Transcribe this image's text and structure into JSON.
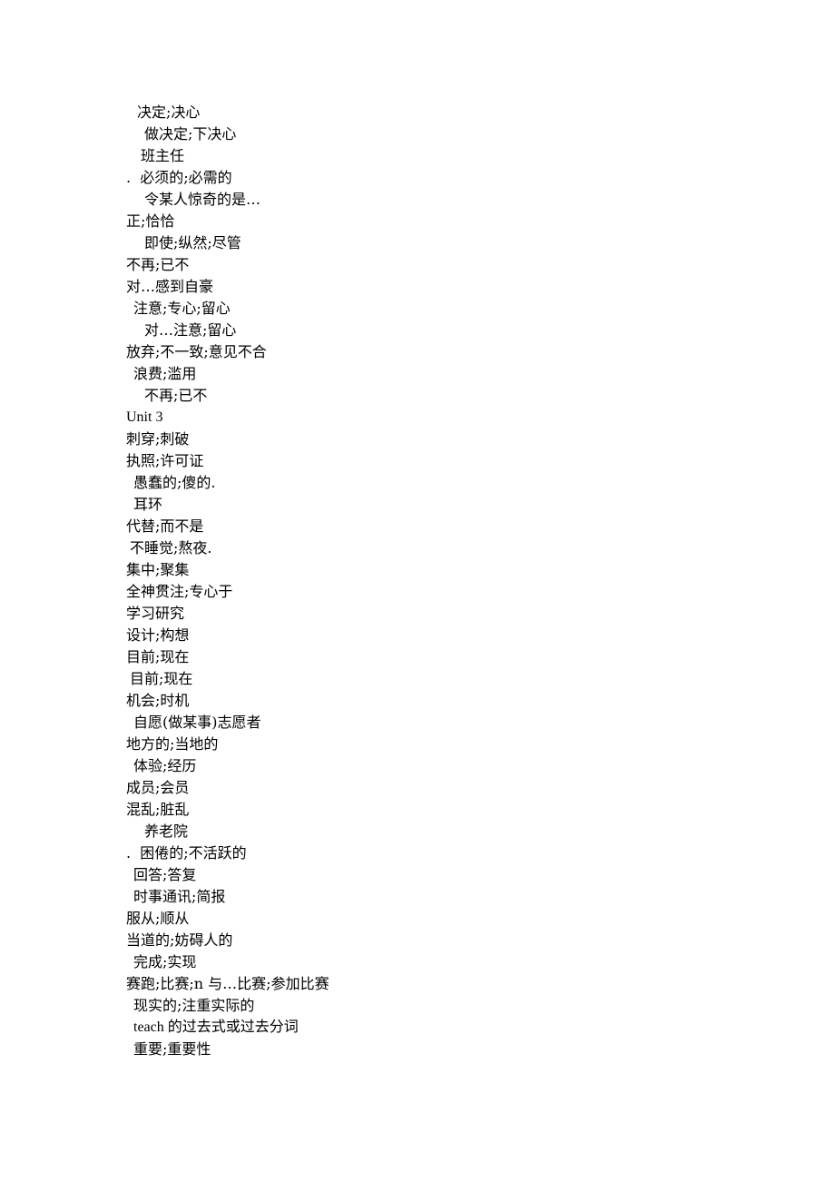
{
  "document": {
    "lines": [
      {
        "indent": 3,
        "text": "决定;决心"
      },
      {
        "indent": 5,
        "text": "做决定;下决心"
      },
      {
        "indent": 4,
        "text": "班主任"
      },
      {
        "indent": 0,
        "text": ".  必须的;必需的"
      },
      {
        "indent": 5,
        "text": "令某人惊奇的是…"
      },
      {
        "indent": 0,
        "text": "正;恰恰"
      },
      {
        "indent": 5,
        "text": "即使;纵然;尽管"
      },
      {
        "indent": 0,
        "text": "不再;已不"
      },
      {
        "indent": 0,
        "text": "对…感到自豪"
      },
      {
        "indent": 2,
        "text": "注意;专心;留心"
      },
      {
        "indent": 5,
        "text": "对…注意;留心"
      },
      {
        "indent": 0,
        "text": "放弃;不一致;意见不合"
      },
      {
        "indent": 2,
        "text": "浪费;滥用"
      },
      {
        "indent": 5,
        "text": "不再;已不"
      },
      {
        "indent": 0,
        "text": "Unit 3"
      },
      {
        "indent": 0,
        "text": "刺穿;刺破"
      },
      {
        "indent": 0,
        "text": "执照;许可证"
      },
      {
        "indent": 2,
        "text": "愚蠢的;傻的."
      },
      {
        "indent": 2,
        "text": "耳环"
      },
      {
        "indent": 0,
        "text": "代替;而不是"
      },
      {
        "indent": 1,
        "text": "不睡觉;熬夜."
      },
      {
        "indent": 0,
        "text": "集中;聚集"
      },
      {
        "indent": 0,
        "text": "全神贯注;专心于"
      },
      {
        "indent": 0,
        "text": "学习研究"
      },
      {
        "indent": 0,
        "text": "设计;构想"
      },
      {
        "indent": 0,
        "text": "目前;现在"
      },
      {
        "indent": 1,
        "text": "目前;现在"
      },
      {
        "indent": 0,
        "text": "机会;时机"
      },
      {
        "indent": 2,
        "text": "自愿(做某事)志愿者"
      },
      {
        "indent": 0,
        "text": "地方的;当地的"
      },
      {
        "indent": 2,
        "text": "体验;经历"
      },
      {
        "indent": 0,
        "text": "成员;会员"
      },
      {
        "indent": 0,
        "text": "混乱;脏乱"
      },
      {
        "indent": 5,
        "text": "养老院"
      },
      {
        "indent": 0,
        "text": ".  困倦的;不活跃的"
      },
      {
        "indent": 2,
        "text": "回答;答复"
      },
      {
        "indent": 2,
        "text": "时事通讯;简报"
      },
      {
        "indent": 0,
        "text": "服从;顺从"
      },
      {
        "indent": 0,
        "text": "当道的;妨碍人的"
      },
      {
        "indent": 2,
        "text": "完成;实现"
      },
      {
        "indent": 0,
        "text": "赛跑;比赛;n 与…比赛;参加比赛"
      },
      {
        "indent": 2,
        "text": "现实的;注重实际的"
      },
      {
        "indent": 2,
        "text": "teach 的过去式或过去分词"
      },
      {
        "indent": 2,
        "text": "重要;重要性"
      }
    ]
  }
}
